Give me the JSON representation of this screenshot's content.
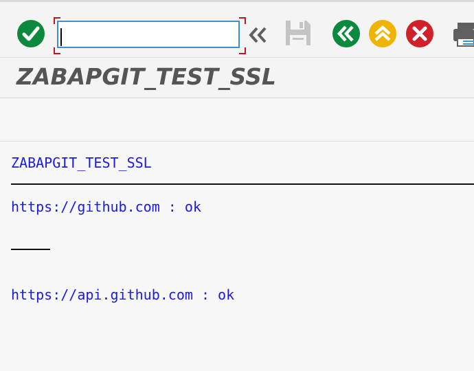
{
  "toolbar": {
    "command_field": {
      "value": "",
      "placeholder": ""
    },
    "icons": {
      "enter": "green-checkmark-icon",
      "history": "double-chevron-left-icon",
      "save": "floppy-disk-icon",
      "back": "green-back-icon",
      "exit": "yellow-up-icon",
      "cancel": "red-cancel-icon",
      "print": "printer-icon"
    },
    "colors": {
      "green": "#0b8a3e",
      "yellow": "#f0b400",
      "red": "#d0202a",
      "gray": "#9a9a9a"
    }
  },
  "title_bar": {
    "title": "ZABAPGIT_TEST_SSL"
  },
  "list_output": {
    "header": "ZABAPGIT_TEST_SSL",
    "lines": [
      "https://github.com : ok",
      "https://api.github.com : ok"
    ],
    "text_color": "#1a1ae6"
  }
}
